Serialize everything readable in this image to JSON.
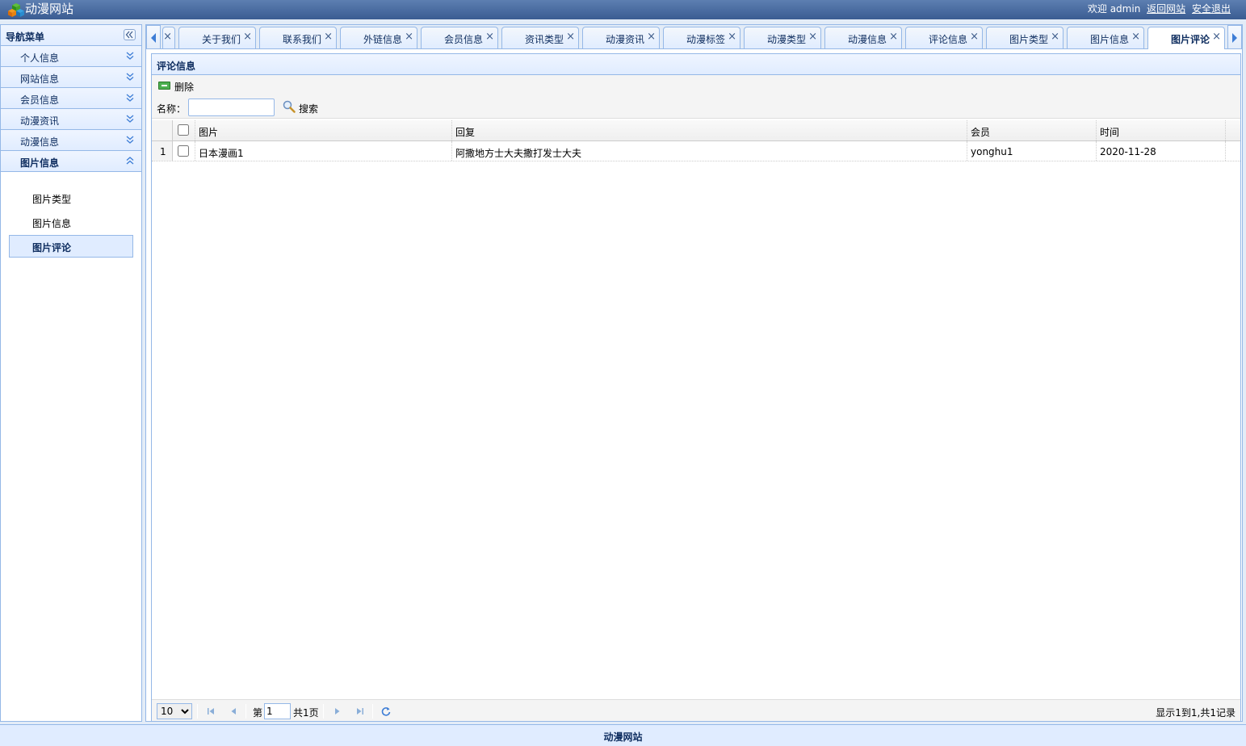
{
  "header": {
    "site_title": "动漫网站",
    "welcome": "欢迎 admin",
    "back_link": "返回网站",
    "logout_link": "安全退出"
  },
  "sidebar": {
    "title": "导航菜单",
    "sections": [
      {
        "label": "个人信息"
      },
      {
        "label": "网站信息"
      },
      {
        "label": "会员信息"
      },
      {
        "label": "动漫资讯"
      },
      {
        "label": "动漫信息"
      },
      {
        "label": "图片信息"
      }
    ],
    "open_items": [
      {
        "label": "图片类型"
      },
      {
        "label": "图片信息"
      },
      {
        "label": "图片评论"
      }
    ]
  },
  "tabs": [
    {
      "label": "关于我们"
    },
    {
      "label": "联系我们"
    },
    {
      "label": "外链信息"
    },
    {
      "label": "会员信息"
    },
    {
      "label": "资讯类型"
    },
    {
      "label": "动漫资讯"
    },
    {
      "label": "动漫标签"
    },
    {
      "label": "动漫类型"
    },
    {
      "label": "动漫信息"
    },
    {
      "label": "评论信息"
    },
    {
      "label": "图片类型"
    },
    {
      "label": "图片信息"
    },
    {
      "label": "图片评论"
    }
  ],
  "tab_close_glyph": "×",
  "panel": {
    "title": "评论信息",
    "delete_label": "删除",
    "search_label": "名称：",
    "search_value": "",
    "search_button": "搜索"
  },
  "grid": {
    "columns": [
      "图片",
      "回复",
      "会员",
      "时间"
    ],
    "rows": [
      {
        "num": "1",
        "image": "日本漫画1",
        "reply": "阿撒地方士大夫撒打发士大夫",
        "member": "yonghu1",
        "time": "2020-11-28"
      }
    ]
  },
  "pager": {
    "page_size": "10",
    "page_prefix": "第",
    "page_value": "1",
    "page_total": "共1页",
    "info": "显示1到1,共1记录"
  },
  "footer": {
    "text": "动漫网站"
  },
  "colors": {
    "header_bg": "#3a5c92",
    "border": "#95b8e7",
    "panel_header_bg": "#e0ecff"
  }
}
